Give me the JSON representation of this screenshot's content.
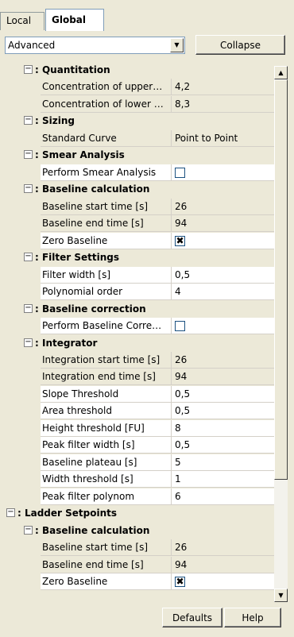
{
  "tabs": [
    {
      "label": "Local"
    },
    {
      "label": "Global"
    }
  ],
  "dropdown": {
    "value": "Advanced"
  },
  "collapse_label": "Collapse",
  "icons": {
    "toggle": "minus-icon",
    "dropdown": "chevron-down-icon",
    "scroll_up": "arrow-up-icon",
    "scroll_down": "arrow-down-icon"
  },
  "rows": [
    {
      "type": "cat",
      "indent": 1,
      "label": ": Quantitation"
    },
    {
      "type": "prop",
      "name": "Concentration of upper…",
      "value": "4,2",
      "bg": "grey"
    },
    {
      "type": "prop",
      "name": "Concentration of lower …",
      "value": "8,3",
      "bg": "grey"
    },
    {
      "type": "cat",
      "indent": 1,
      "label": ": Sizing"
    },
    {
      "type": "prop",
      "name": "Standard Curve",
      "value": "Point to Point",
      "bg": "grey"
    },
    {
      "type": "cat",
      "indent": 1,
      "label": ": Smear Analysis"
    },
    {
      "type": "prop",
      "name": "Perform Smear Analysis",
      "check": false,
      "bg": "white"
    },
    {
      "type": "cat",
      "indent": 1,
      "label": ": Baseline calculation"
    },
    {
      "type": "prop",
      "name": "Baseline start time [s]",
      "value": "26",
      "bg": "grey"
    },
    {
      "type": "prop",
      "name": "Baseline end time [s]",
      "value": "94",
      "bg": "grey"
    },
    {
      "type": "prop",
      "name": "Zero Baseline",
      "check": true,
      "bg": "white"
    },
    {
      "type": "cat",
      "indent": 1,
      "label": ": Filter Settings"
    },
    {
      "type": "prop",
      "name": "Filter width [s]",
      "value": "0,5",
      "bg": "white"
    },
    {
      "type": "prop",
      "name": "Polynomial order",
      "value": "4",
      "bg": "white"
    },
    {
      "type": "cat",
      "indent": 1,
      "label": ": Baseline correction"
    },
    {
      "type": "prop",
      "name": "Perform Baseline Corre…",
      "check": false,
      "bg": "white"
    },
    {
      "type": "cat",
      "indent": 1,
      "label": ": Integrator"
    },
    {
      "type": "prop",
      "name": "Integration start time [s]",
      "value": "26",
      "bg": "grey"
    },
    {
      "type": "prop",
      "name": "Integration end time [s]",
      "value": "94",
      "bg": "grey"
    },
    {
      "type": "prop",
      "name": "Slope Threshold",
      "value": "0,5",
      "bg": "white"
    },
    {
      "type": "prop",
      "name": "Area threshold",
      "value": "0,5",
      "bg": "white"
    },
    {
      "type": "prop",
      "name": "Height threshold [FU]",
      "value": "8",
      "bg": "white"
    },
    {
      "type": "prop",
      "name": "Peak filter width [s]",
      "value": "0,5",
      "bg": "white"
    },
    {
      "type": "prop",
      "name": "Baseline plateau [s]",
      "value": "5",
      "bg": "white"
    },
    {
      "type": "prop",
      "name": "Width threshold [s]",
      "value": "1",
      "bg": "white"
    },
    {
      "type": "prop",
      "name": "Peak filter polynom",
      "value": "6",
      "bg": "white"
    },
    {
      "type": "cat",
      "indent": 0,
      "label": ": Ladder Setpoints"
    },
    {
      "type": "cat",
      "indent": 1,
      "label": ": Baseline calculation"
    },
    {
      "type": "prop",
      "name": "Baseline start time [s]",
      "value": "26",
      "bg": "grey"
    },
    {
      "type": "prop",
      "name": "Baseline end time [s]",
      "value": "94",
      "bg": "grey"
    },
    {
      "type": "prop",
      "name": "Zero Baseline",
      "check": true,
      "bg": "white"
    }
  ],
  "defaults_label": "Defaults",
  "help_label": "Help"
}
